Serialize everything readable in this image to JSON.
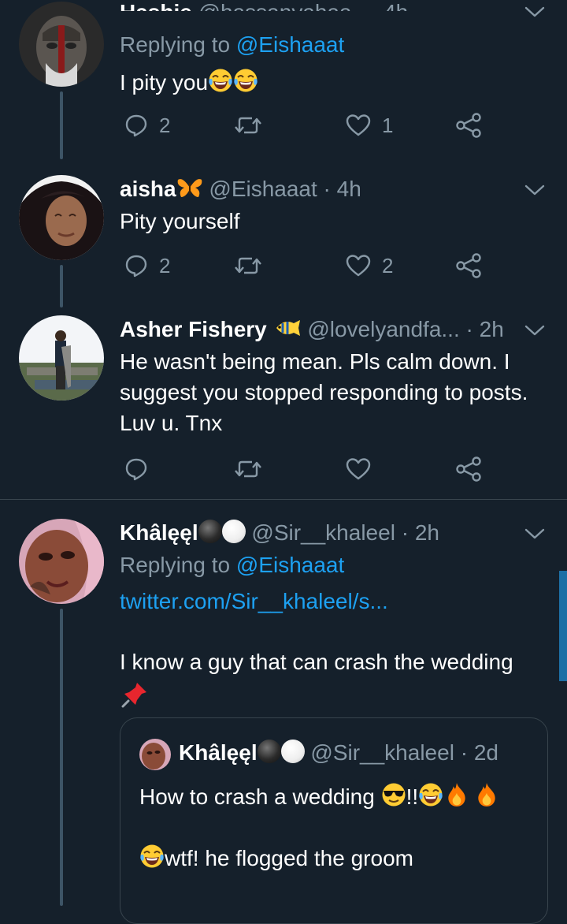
{
  "tweets": [
    {
      "replying_prefix": "Replying to ",
      "replying_handle": "@Eishaaat",
      "text": "I pity you",
      "text_emojis": [
        "face-with-tears-of-joy-icon",
        "face-with-tears-of-joy-icon"
      ],
      "replies": "2",
      "retweets": "",
      "likes": "1"
    },
    {
      "name": "aisha",
      "name_emoji": "butterfly-icon",
      "handle": "@Eishaaat",
      "time": "4h",
      "text": "Pity yourself",
      "replies": "2",
      "retweets": "",
      "likes": "2"
    },
    {
      "name": "Asher Fishery",
      "name_emoji": "tropical-fish-icon",
      "handle": "@lovelyandfa...",
      "time": "2h",
      "text": "He wasn't being mean. Pls calm down. I suggest you stopped responding to posts. Luv u. Tnx",
      "replies": "",
      "retweets": "",
      "likes": ""
    },
    {
      "name": "Khâlęęl",
      "name_emojis": [
        "black-circle-icon",
        "white-circle-icon"
      ],
      "handle": "@Sir__khaleel",
      "time": "2h",
      "replying_prefix": "Replying to ",
      "replying_handle": "@Eishaaat",
      "link": "twitter.com/Sir__khaleel/s...",
      "text": "I know a guy that can crash the wedding",
      "text_emoji": "pushpin-icon",
      "quoted": {
        "name": "Khâlęęl",
        "handle": "@Sir__khaleel",
        "time": "2d",
        "line1": "How to crash a wedding",
        "line1_suffix": "!!",
        "line1_emojis": [
          "sunglasses-face-icon",
          "face-with-tears-of-joy-icon",
          "fire-icon",
          "fire-icon"
        ],
        "line2": "wtf! he flogged the groom"
      }
    }
  ],
  "separator": " · ",
  "colors": {
    "background": "#15202b",
    "primary_text": "#ffffff",
    "secondary_text": "#8899a6",
    "accent": "#1da1f2",
    "divider": "#38444d"
  }
}
